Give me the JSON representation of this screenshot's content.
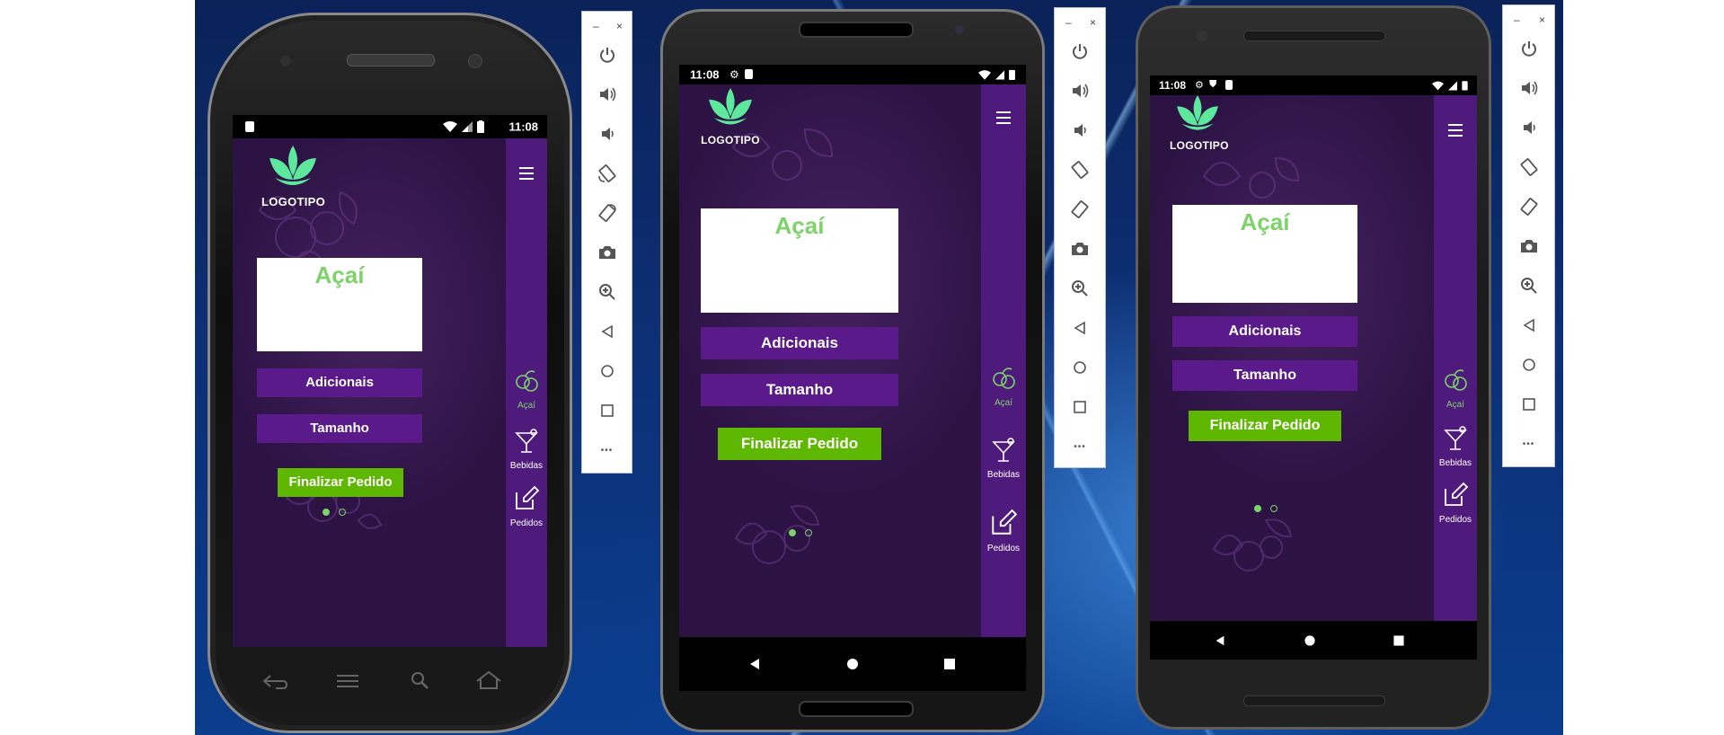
{
  "colors": {
    "accent_green": "#7dd36a",
    "purple": "#5a1a8a",
    "sidebar": "#4e1a7c",
    "button_green": "#5eb700"
  },
  "emulators": [
    {
      "status_time": "11:08",
      "logo_text": "LOGOTIPO",
      "card_title": "Açaí",
      "button_extras": "Adicionais",
      "button_size": "Tamanho",
      "button_finish": "Finalizar Pedido",
      "sidebar": [
        "Açaí",
        "Bebidas",
        "Pedidos"
      ]
    },
    {
      "status_time": "11:08",
      "logo_text": "LOGOTIPO",
      "card_title": "Açaí",
      "button_extras": "Adicionais",
      "button_size": "Tamanho",
      "button_finish": "Finalizar Pedido",
      "sidebar": [
        "Açaí",
        "Bebidas",
        "Pedidos"
      ]
    },
    {
      "status_time": "11:08",
      "logo_text": "LOGOTIPO",
      "card_title": "Açaí",
      "button_extras": "Adicionais",
      "button_size": "Tamanho",
      "button_finish": "Finalizar Pedido",
      "sidebar": [
        "Açaí",
        "Bebidas",
        "Pedidos"
      ]
    }
  ],
  "toolbar_icons": [
    "power-icon",
    "volume-up-icon",
    "volume-down-icon",
    "rotate-left-icon",
    "rotate-right-icon",
    "camera-icon",
    "zoom-icon",
    "back-icon",
    "home-icon",
    "overview-icon",
    "more-icon"
  ],
  "toolbar_labels": {
    "minimize": "–",
    "close": "×",
    "more": "•••"
  }
}
